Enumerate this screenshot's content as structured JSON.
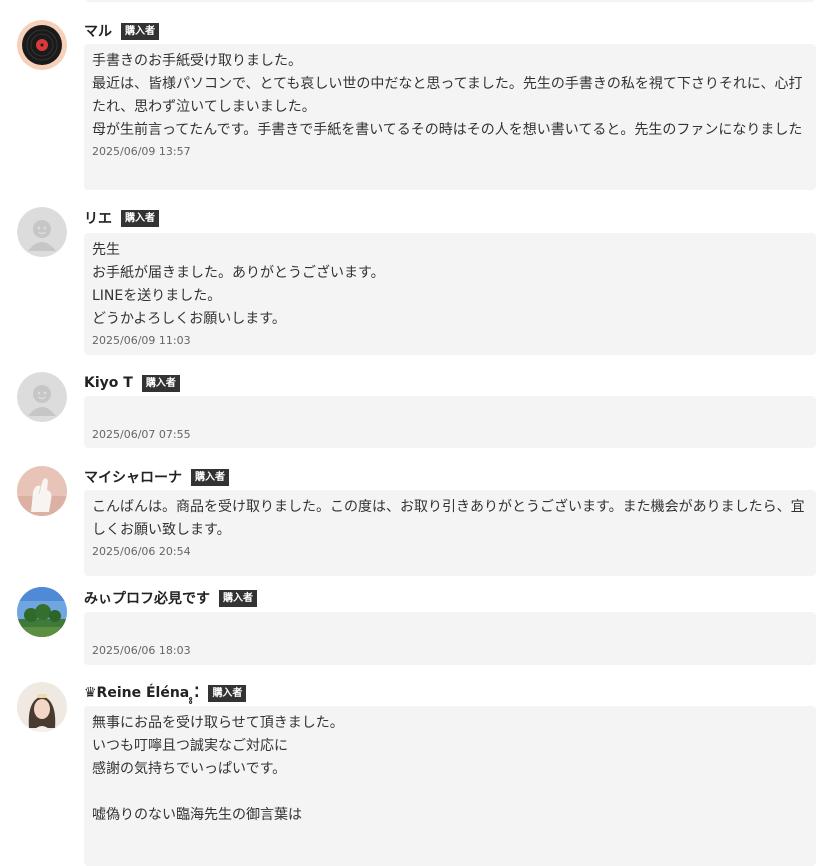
{
  "buyer_badge": "購入者",
  "comments": [
    {
      "user": "マル",
      "avatar": "vinyl-record-icon",
      "text": "手書きのお手紙受け取りました。\n最近は、皆様パソコンで、とても哀しい世の中だなと思ってました。先生の手書きの私を視て下さりそれに、心打たれ、思わず泣いてしまいました。\n母が生前言ってたんです。手書きで手紙を書いてるその時はその人を想い書いてると。先生のファンになりました",
      "date": "2025/06/09 13:57"
    },
    {
      "user": "リエ",
      "avatar": "default-user-icon",
      "text": "先生\nお手紙が届きました。ありがとうございます。\nLINEを送りました。\nどうかよろしくお願いします。",
      "date": "2025/06/09 11:03"
    },
    {
      "user": "Kiyo T",
      "avatar": "default-user-icon",
      "text": "",
      "date": "2025/06/07 07:55"
    },
    {
      "user": "マイシャローナ",
      "avatar": "hand-photo-avatar",
      "text": "こんばんは。商品を受け取りました。この度は、お取り引きありがとうございます。また機会がありましたら、宜しくお願い致します。",
      "date": "2025/06/06 20:54"
    },
    {
      "user": "みぃプロフ必見です",
      "avatar": "landscape-photo-avatar",
      "text": "",
      "date": "2025/06/06 18:03"
    },
    {
      "user": "♛Reine Éléna ̥̥⁚",
      "avatar": "portrait-photo-avatar",
      "text": "無事にお品を受け取らせて頂きました。\nいつも叮嚀且つ誠実なご対応に\n感謝の気持ちでいっぱいです。\n\n嘘偽りのない臨海先生の御言葉は",
      "date": ""
    }
  ]
}
